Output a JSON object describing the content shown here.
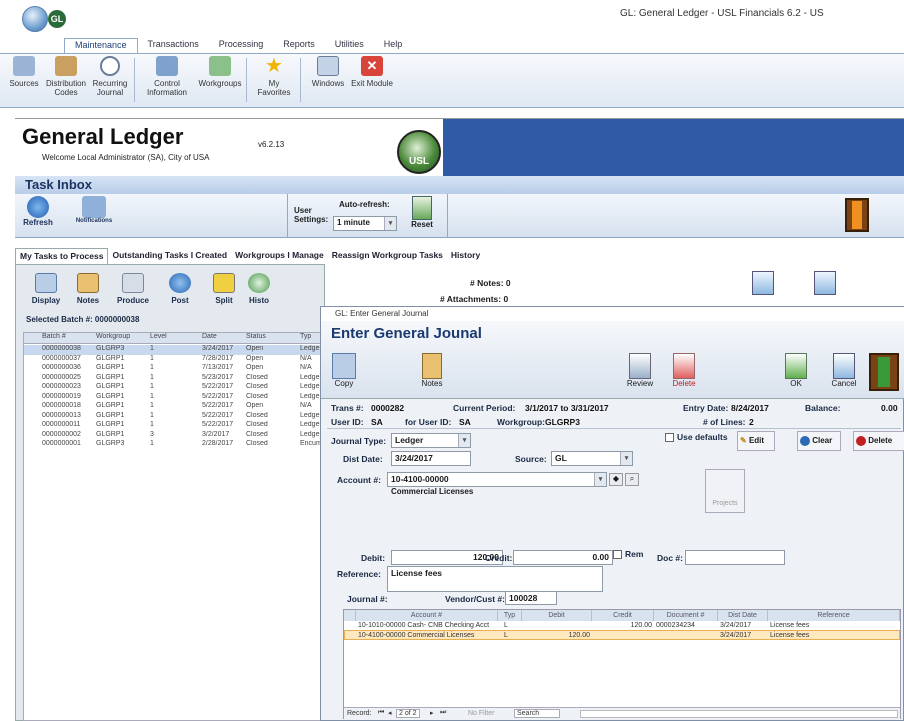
{
  "window": {
    "title": "GL: General Ledger - USL Financials 6.2 - US",
    "app_badge": "GL"
  },
  "ribbon": {
    "tabs": [
      "Maintenance",
      "Transactions",
      "Processing",
      "Reports",
      "Utilities",
      "Help"
    ],
    "active_tab": "Maintenance",
    "buttons": [
      {
        "label": "Sources",
        "icon": "sources-icon"
      },
      {
        "label": "Distribution Codes",
        "icon": "distribution-icon"
      },
      {
        "label": "Recurring Journal",
        "icon": "clock-icon"
      },
      {
        "label": "Control Information",
        "icon": "control-icon"
      },
      {
        "label": "Workgroups",
        "icon": "workgroups-icon"
      },
      {
        "label": "My Favorites",
        "icon": "star-icon"
      },
      {
        "label": "Windows",
        "icon": "windows-icon"
      },
      {
        "label": "Exit Module",
        "icon": "exit-icon"
      }
    ]
  },
  "header": {
    "title": "General Ledger",
    "welcome": "Welcome Local Administrator (SA), City of USA",
    "version": "v6.2.13",
    "logo_text": "USL"
  },
  "task_inbox": {
    "title": "Task Inbox",
    "refresh_label": "Refresh",
    "notifications_label": "Notifications",
    "user_settings_label": "User Settings:",
    "auto_refresh_label": "Auto-refresh:",
    "auto_refresh_value": "1 minute",
    "reset_label": "Reset"
  },
  "task_tabs": [
    "My Tasks to Process",
    "Outstanding Tasks I Created",
    "Workgroups I Manage",
    "Reassign Workgroup Tasks",
    "History"
  ],
  "task_toolbar": {
    "buttons": [
      "Display",
      "Notes",
      "Produce",
      "Post",
      "Split",
      "Histo"
    ],
    "notes_count": "# Notes: 0",
    "attachments_count": "# Attachments: 0",
    "selected_batch": "Selected Batch #: 0000000038"
  },
  "task_grid": {
    "columns": [
      "Batch #",
      "Workgroup",
      "Level",
      "Date",
      "Status",
      "Typ"
    ],
    "rows": [
      [
        "0000000038",
        "GLGRP3",
        "1",
        "3/24/2017",
        "Open",
        "Ledger"
      ],
      [
        "0000000037",
        "GLGRP1",
        "1",
        "7/28/2017",
        "Open",
        "N/A"
      ],
      [
        "0000000036",
        "GLGRP1",
        "1",
        "7/13/2017",
        "Open",
        "N/A"
      ],
      [
        "0000000025",
        "GLGRP1",
        "1",
        "5/23/2017",
        "Closed",
        "Ledger"
      ],
      [
        "0000000023",
        "GLGRP1",
        "1",
        "5/22/2017",
        "Closed",
        "Ledger"
      ],
      [
        "0000000019",
        "GLGRP1",
        "1",
        "5/22/2017",
        "Closed",
        "Ledger"
      ],
      [
        "0000000018",
        "GLGRP1",
        "1",
        "5/22/2017",
        "Open",
        "N/A"
      ],
      [
        "0000000013",
        "GLGRP1",
        "1",
        "5/22/2017",
        "Closed",
        "Ledger"
      ],
      [
        "0000000011",
        "GLGRP1",
        "1",
        "5/22/2017",
        "Closed",
        "Ledger"
      ],
      [
        "0000000002",
        "GLGRP1",
        "3",
        "3/2/2017",
        "Closed",
        "Ledger"
      ],
      [
        "0000000001",
        "GLGRP3",
        "1",
        "2/28/2017",
        "Closed",
        "Encum"
      ]
    ]
  },
  "dialog": {
    "window_title": "GL: Enter General Journal",
    "title": "Enter General Jounal",
    "toolbar": {
      "copy": "Copy",
      "notes": "Notes",
      "review": "Review",
      "delete": "Delete",
      "ok": "OK",
      "cancel": "Cancel"
    },
    "trans_label": "Trans #:",
    "trans_value": "0000282",
    "period_label": "Current Period:",
    "period_value": "3/1/2017  to  3/31/2017",
    "entry_date_label": "Entry Date:",
    "entry_date_value": "8/24/2017",
    "balance_label": "Balance:",
    "balance_value": "0.00",
    "user_label": "User ID:",
    "user_value": "SA",
    "for_user_label": "for User ID:",
    "for_user_value": "SA",
    "workgroup_label": "Workgroup:",
    "workgroup_value": "GLGRP3",
    "lines_label": "# of Lines:",
    "lines_value": "2",
    "journal_type_label": "Journal Type:",
    "journal_type_value": "Ledger",
    "use_defaults_label": "Use defaults",
    "edit_label": "Edit",
    "clear_label": "Clear",
    "delete_label": "Delete",
    "dist_date_label": "Dist Date:",
    "dist_date_value": "3/24/2017",
    "source_label": "Source:",
    "source_value": "GL",
    "account_label": "Account #:",
    "account_value": "10-4100-00000",
    "account_desc": "Commercial Licenses",
    "projects_label": "Projects",
    "debit_label": "Debit:",
    "debit_value": "120.00",
    "credit_label": "Credit:",
    "credit_value": "0.00",
    "rem_label": "Rem",
    "doc_label": "Doc #:",
    "reference_label": "Reference:",
    "reference_value": "License fees",
    "journal_label": "Journal #:",
    "vendor_label": "Vendor/Cust #:",
    "vendor_value": "100028",
    "grid": {
      "columns": [
        "Account #",
        "Typ",
        "Debit",
        "Credit",
        "Document #",
        "Dist Date",
        "Reference"
      ],
      "rows": [
        [
          "10-1010-00000  Cash- CNB Checking Acct",
          "L",
          "",
          "120.00",
          "0000234234",
          "3/24/2017",
          "License fees"
        ],
        [
          "10-4100-00000  Commercial Licenses",
          "L",
          "120.00",
          "",
          "",
          "3/24/2017",
          "License fees"
        ]
      ]
    },
    "nav": {
      "record_label": "Record:",
      "record_value": "2 of 2",
      "no_filter": "No Filter",
      "search": "Search"
    }
  }
}
